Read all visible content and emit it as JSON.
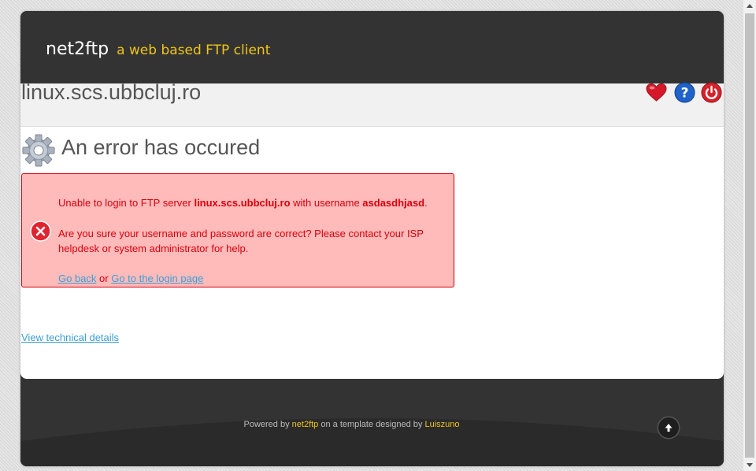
{
  "header": {
    "brand": "net2ftp",
    "tagline": "a web based FTP client"
  },
  "hostbar": {
    "hostname": "linux.scs.ubbcluj.ro",
    "icons": [
      "bookmark-heart-icon",
      "help-icon",
      "logout-power-icon"
    ]
  },
  "error": {
    "title": "An error has occured",
    "line1": {
      "prefix": "Unable to login to FTP server ",
      "server": "linux.scs.ubbcluj.ro",
      "middle": " with username ",
      "username": "asdasdhjasd",
      "suffix": "."
    },
    "line2a": "Are you sure your username and password are correct? Please contact your ISP",
    "line2b": "helpdesk or system administrator for help.",
    "go_back": "Go back",
    "or": " or ",
    "login_page": "Go to the login page"
  },
  "technical_link": "View technical details",
  "footer": {
    "powered": "Powered by ",
    "app": "net2ftp",
    "template": " on a template designed by ",
    "designer": "Luiszuno"
  },
  "colors": {
    "frame": "#333333",
    "accent": "#f0c419",
    "error_bg": "#ffbaba",
    "error_text": "#d8000c",
    "link": "#3a9fd6"
  }
}
